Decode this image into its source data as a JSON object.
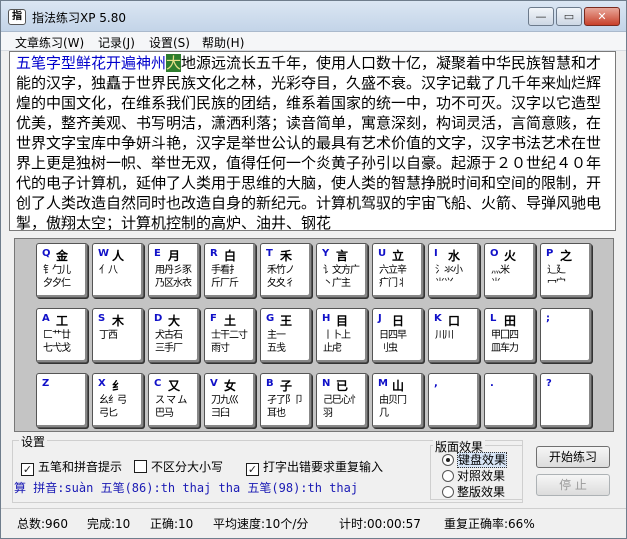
{
  "window": {
    "title": "指法练习XP 5.80",
    "icon_char": "指",
    "minimize_glyph": "—",
    "maximize_glyph": "▭",
    "close_glyph": "✕"
  },
  "menu": [
    "文章练习(W)",
    "记录(J)",
    "设置(S)",
    "帮助(H)"
  ],
  "text": {
    "typed": "五笔字型鲜花开遍神州",
    "current": "大",
    "rest": "地源远流长五千年，使用人口数十亿，凝聚着中华民族智慧和才能的汉字，独矗于世界民族文化之林，光彩夺目，久盛不衰。汉字记载了几千年来灿烂辉煌的中国文化，在维系我们民族的团结，维系着国家的统一中，功不可灭。汉字以它造型优美，整齐美观、书写明洁，潇洒利落；读音简单，寓意深刻，构词灵活，言简意赅，在世界文字宝库中争妍斗艳，汉字是举世公认的最具有艺术价值的文字，汉字书法艺术在世界上更是独树一帜、举世无双，值得任何一个炎黄子孙引以自豪。起源于２０世纪４０年代的电子计算机，延伸了人类用于思维的大脑，使人类的智慧挣脱时间和空间的限制，开创了人类改造自然同时也改造自身的新纪元。计算机驾驭的宇宙飞船、火箭、导弹风驰电掣，傲翔太空；计算机控制的高炉、油井、钢花"
  },
  "keyboard": {
    "rows": [
      [
        {
          "letter": "Q",
          "char": "金",
          "roots": [
            "钅勹儿",
            "夕夕仁"
          ]
        },
        {
          "letter": "W",
          "char": "人",
          "roots": [
            "亻八",
            ""
          ]
        },
        {
          "letter": "E",
          "char": "月",
          "roots": [
            "用丹彡豕",
            "乃区水衣"
          ]
        },
        {
          "letter": "R",
          "char": "白",
          "roots": [
            "手看扌",
            "斤厂斤"
          ]
        },
        {
          "letter": "T",
          "char": "禾",
          "roots": [
            "禾竹ノ",
            "夂夊彳"
          ]
        },
        {
          "letter": "Y",
          "char": "言",
          "roots": [
            "讠文方广",
            "丶广主"
          ]
        },
        {
          "letter": "U",
          "char": "立",
          "roots": [
            "六立辛",
            "疒门丬"
          ]
        },
        {
          "letter": "I",
          "char": "水",
          "roots": [
            "氵氺小",
            "⺌⺍"
          ]
        },
        {
          "letter": "O",
          "char": "火",
          "roots": [
            "灬米",
            "⺌"
          ]
        },
        {
          "letter": "P",
          "char": "之",
          "roots": [
            "辶廴",
            "冖宀"
          ]
        }
      ],
      [
        {
          "letter": "A",
          "char": "工",
          "roots": [
            "匚艹廿",
            "七弋戈"
          ]
        },
        {
          "letter": "S",
          "char": "木",
          "roots": [
            "丁西",
            ""
          ]
        },
        {
          "letter": "D",
          "char": "大",
          "roots": [
            "犬古石",
            "三手厂"
          ]
        },
        {
          "letter": "F",
          "char": "土",
          "roots": [
            "士干二寸",
            "雨寸"
          ]
        },
        {
          "letter": "G",
          "char": "王",
          "roots": [
            "主一",
            "五戋"
          ]
        },
        {
          "letter": "H",
          "char": "目",
          "roots": [
            "丨卜上",
            "止虍"
          ]
        },
        {
          "letter": "J",
          "char": "日",
          "roots": [
            "日四早",
            "刂虫"
          ]
        },
        {
          "letter": "K",
          "char": "口",
          "roots": [
            "川川",
            ""
          ]
        },
        {
          "letter": "L",
          "char": "田",
          "roots": [
            "甲囗四",
            "皿车力"
          ]
        },
        {
          "letter": ";",
          "char": "",
          "roots": [
            "",
            ""
          ]
        }
      ],
      [
        {
          "letter": "Z",
          "char": "",
          "roots": [
            "",
            ""
          ]
        },
        {
          "letter": "X",
          "char": "纟",
          "roots": [
            "幺纟弓",
            "弓匕"
          ]
        },
        {
          "letter": "C",
          "char": "又",
          "roots": [
            "ス マ ム",
            "巴马"
          ]
        },
        {
          "letter": "V",
          "char": "女",
          "roots": [
            "刀九巛",
            "彐臼"
          ]
        },
        {
          "letter": "B",
          "char": "子",
          "roots": [
            "孑了阝卩",
            "耳也"
          ]
        },
        {
          "letter": "N",
          "char": "已",
          "roots": [
            "己巳心忄",
            "羽"
          ]
        },
        {
          "letter": "M",
          "char": "山",
          "roots": [
            "由贝冂",
            "几"
          ]
        },
        {
          "letter": ",",
          "char": "",
          "roots": [
            "",
            ""
          ]
        },
        {
          "letter": ".",
          "char": "",
          "roots": [
            "",
            ""
          ]
        },
        {
          "letter": "?",
          "char": "",
          "roots": [
            "",
            ""
          ]
        }
      ]
    ]
  },
  "settings": {
    "group_label": "设置",
    "opt_wubi_pinyin": {
      "label": "五笔和拼音提示",
      "checked": true
    },
    "opt_case": {
      "label": "不区分大小写",
      "checked": false
    },
    "opt_retype": {
      "label": "打字出错要求重复输入",
      "checked": true
    },
    "hint_line": "算 拼音:suàn 五笔(86):th thaj tha 五笔(98):th thaj"
  },
  "theme": {
    "group_label": "版面效果",
    "options": [
      {
        "label": "键盘效果",
        "selected": true
      },
      {
        "label": "对照效果",
        "selected": false
      },
      {
        "label": "整版效果",
        "selected": false
      }
    ]
  },
  "buttons": {
    "start": "开始练习",
    "stop": "停 止"
  },
  "status": {
    "total": "总数:960",
    "done": "完成:10",
    "correct": "正确:10",
    "speed": "平均速度:10个/分",
    "time": "计时:00:00:57",
    "retype_rate": "重复正确率:66%"
  },
  "colors": {
    "typed_text": "#0000cc",
    "cursor_bg": "#2e7d2e",
    "key_letter": "#1010c8",
    "hint_text": "#1a1ab4"
  }
}
